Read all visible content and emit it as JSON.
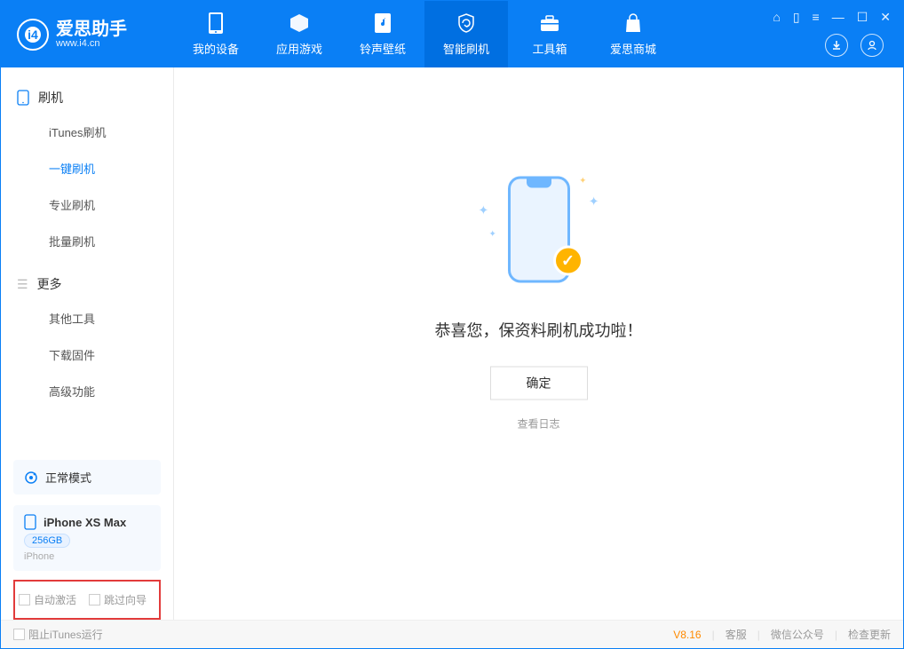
{
  "brand": {
    "name": "爱思助手",
    "url": "www.i4.cn"
  },
  "nav": {
    "device": "我的设备",
    "apps": "应用游戏",
    "ring": "铃声壁纸",
    "flash": "智能刷机",
    "tools": "工具箱",
    "store": "爱思商城"
  },
  "sidebar": {
    "section_flash": "刷机",
    "itunes_flash": "iTunes刷机",
    "one_click": "一键刷机",
    "pro_flash": "专业刷机",
    "batch_flash": "批量刷机",
    "section_more": "更多",
    "other_tools": "其他工具",
    "download_fw": "下载固件",
    "advanced": "高级功能"
  },
  "device_mode": "正常模式",
  "device": {
    "name": "iPhone XS Max",
    "capacity": "256GB",
    "type": "iPhone"
  },
  "options": {
    "auto_activate": "自动激活",
    "skip_guide": "跳过向导"
  },
  "main": {
    "success_text": "恭喜您，保资料刷机成功啦！",
    "ok": "确定",
    "view_log": "查看日志"
  },
  "statusbar": {
    "block_itunes": "阻止iTunes运行",
    "version": "V8.16",
    "support": "客服",
    "wechat": "微信公众号",
    "update": "检查更新"
  }
}
